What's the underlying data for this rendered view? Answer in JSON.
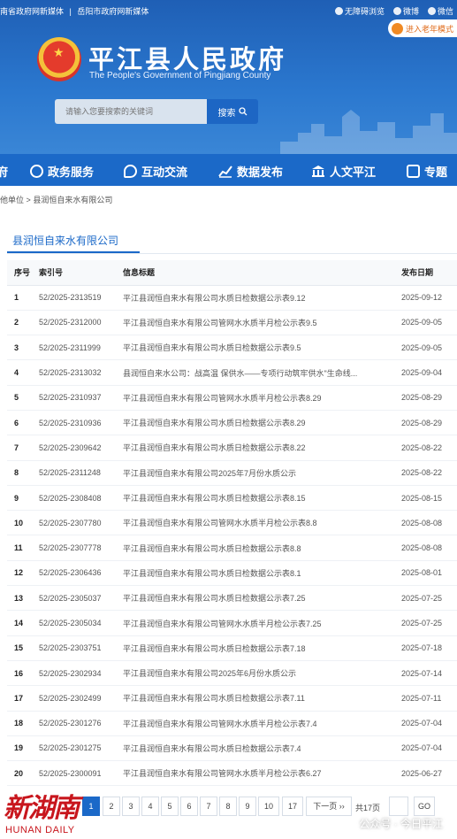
{
  "topbar": {
    "links": [
      "南省政府网新媒体",
      "|",
      "岳阳市政府网新媒体"
    ],
    "accessibility": "无障碍浏览",
    "weibo": "微博",
    "wechat": "微信",
    "elder_mode": "进入老年模式"
  },
  "site": {
    "title_cn": "平江县人民政府",
    "title_en": "The People's Government of Pingjiang County"
  },
  "search": {
    "placeholder": "请输入您要搜索的关键词",
    "button": "搜索"
  },
  "nav": [
    {
      "label": "府",
      "icon": "building-icon"
    },
    {
      "label": "政务服务",
      "icon": "handshake-icon"
    },
    {
      "label": "互动交流",
      "icon": "chat-icon"
    },
    {
      "label": "数据发布",
      "icon": "chart-icon"
    },
    {
      "label": "人文平江",
      "icon": "landmark-icon"
    },
    {
      "label": "专题",
      "icon": "topic-icon"
    }
  ],
  "breadcrumb": {
    "parent": "他单位",
    "sep": ">",
    "current": "县润恒自来水有限公司"
  },
  "panel_title": "县润恒自来水有限公司",
  "table": {
    "headers": [
      "序号",
      "索引号",
      "信息标题",
      "发布日期"
    ],
    "rows": [
      [
        "1",
        "52/2025-2313519",
        "平江县润恒自来水有限公司水质日检数据公示表9.12",
        "2025-09-12"
      ],
      [
        "2",
        "52/2025-2312000",
        "平江县润恒自来水有限公司管网水水质半月检公示表9.5",
        "2025-09-05"
      ],
      [
        "3",
        "52/2025-2311999",
        "平江县润恒自来水有限公司水质日检数据公示表9.5",
        "2025-09-05"
      ],
      [
        "4",
        "52/2025-2313032",
        "县润恒自来水公司：战高温 保供水——专项行动筑牢供水\"生命线...",
        "2025-09-04"
      ],
      [
        "5",
        "52/2025-2310937",
        "平江县润恒自来水有限公司管网水水质半月检公示表8.29",
        "2025-08-29"
      ],
      [
        "6",
        "52/2025-2310936",
        "平江县润恒自来水有限公司水质日检数据公示表8.29",
        "2025-08-29"
      ],
      [
        "7",
        "52/2025-2309642",
        "平江县润恒自来水有限公司水质日检数据公示表8.22",
        "2025-08-22"
      ],
      [
        "8",
        "52/2025-2311248",
        "平江县润恒自来水有限公司2025年7月份水质公示",
        "2025-08-22"
      ],
      [
        "9",
        "52/2025-2308408",
        "平江县润恒自来水有限公司水质日检数据公示表8.15",
        "2025-08-15"
      ],
      [
        "10",
        "52/2025-2307780",
        "平江县润恒自来水有限公司管网水水质半月检公示表8.8",
        "2025-08-08"
      ],
      [
        "11",
        "52/2025-2307778",
        "平江县润恒自来水有限公司水质日检数据公示表8.8",
        "2025-08-08"
      ],
      [
        "12",
        "52/2025-2306436",
        "平江县润恒自来水有限公司水质日检数据公示表8.1",
        "2025-08-01"
      ],
      [
        "13",
        "52/2025-2305037",
        "平江县润恒自来水有限公司水质日检数据公示表7.25",
        "2025-07-25"
      ],
      [
        "14",
        "52/2025-2305034",
        "平江县润恒自来水有限公司管网水水质半月检公示表7.25",
        "2025-07-25"
      ],
      [
        "15",
        "52/2025-2303751",
        "平江县润恒自来水有限公司水质日检数据公示表7.18",
        "2025-07-18"
      ],
      [
        "16",
        "52/2025-2302934",
        "平江县润恒自来水有限公司2025年6月份水质公示",
        "2025-07-14"
      ],
      [
        "17",
        "52/2025-2302499",
        "平江县润恒自来水有限公司水质日检数据公示表7.11",
        "2025-07-11"
      ],
      [
        "18",
        "52/2025-2301276",
        "平江县润恒自来水有限公司管网水水质半月检公示表7.4",
        "2025-07-04"
      ],
      [
        "19",
        "52/2025-2301275",
        "平江县润恒自来水有限公司水质日检数据公示表7.4",
        "2025-07-04"
      ],
      [
        "20",
        "52/2025-2300091",
        "平江县润恒自来水有限公司管网水水质半月检公示表6.27",
        "2025-06-27"
      ]
    ]
  },
  "pagination": {
    "pages": [
      "1",
      "2",
      "3",
      "4",
      "5",
      "6",
      "7",
      "8",
      "9",
      "10",
      "17"
    ],
    "current": "1",
    "next": "下一页 ››",
    "total": "共17页",
    "go": "GO"
  },
  "watermark": {
    "logo": "新湖南",
    "logo_sub": "HUNAN DAILY",
    "account": "公众号 · 今日平江"
  }
}
